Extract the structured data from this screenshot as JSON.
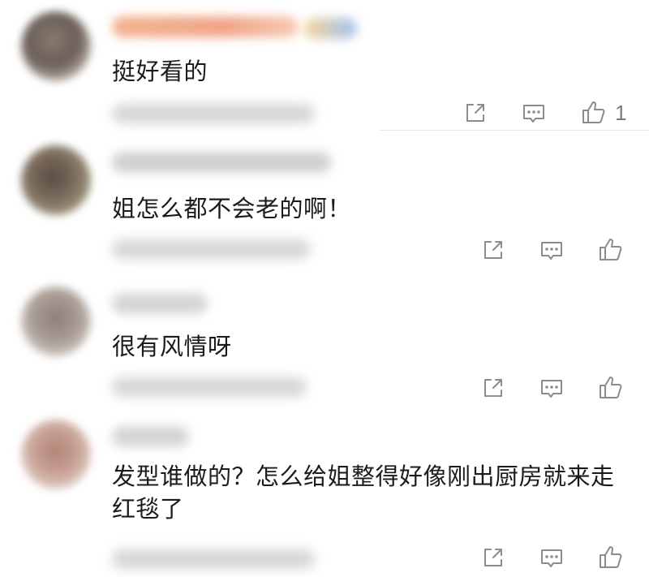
{
  "comments": [
    {
      "text": "挺好看的",
      "like_count": "1"
    },
    {
      "text": "姐怎么都不会老的啊！",
      "like_count": ""
    },
    {
      "text": "很有风情呀",
      "like_count": ""
    },
    {
      "text": "发型谁做的？怎么给姐整得好像刚出厨房就来走红毯了",
      "like_count": ""
    }
  ],
  "icons": {
    "share": "share-icon",
    "reply": "comment-icon",
    "like": "thumbs-up-icon"
  },
  "colors": {
    "text": "#1b1b1b",
    "icon": "#8c8c8c",
    "divider": "#e6e6e6"
  }
}
